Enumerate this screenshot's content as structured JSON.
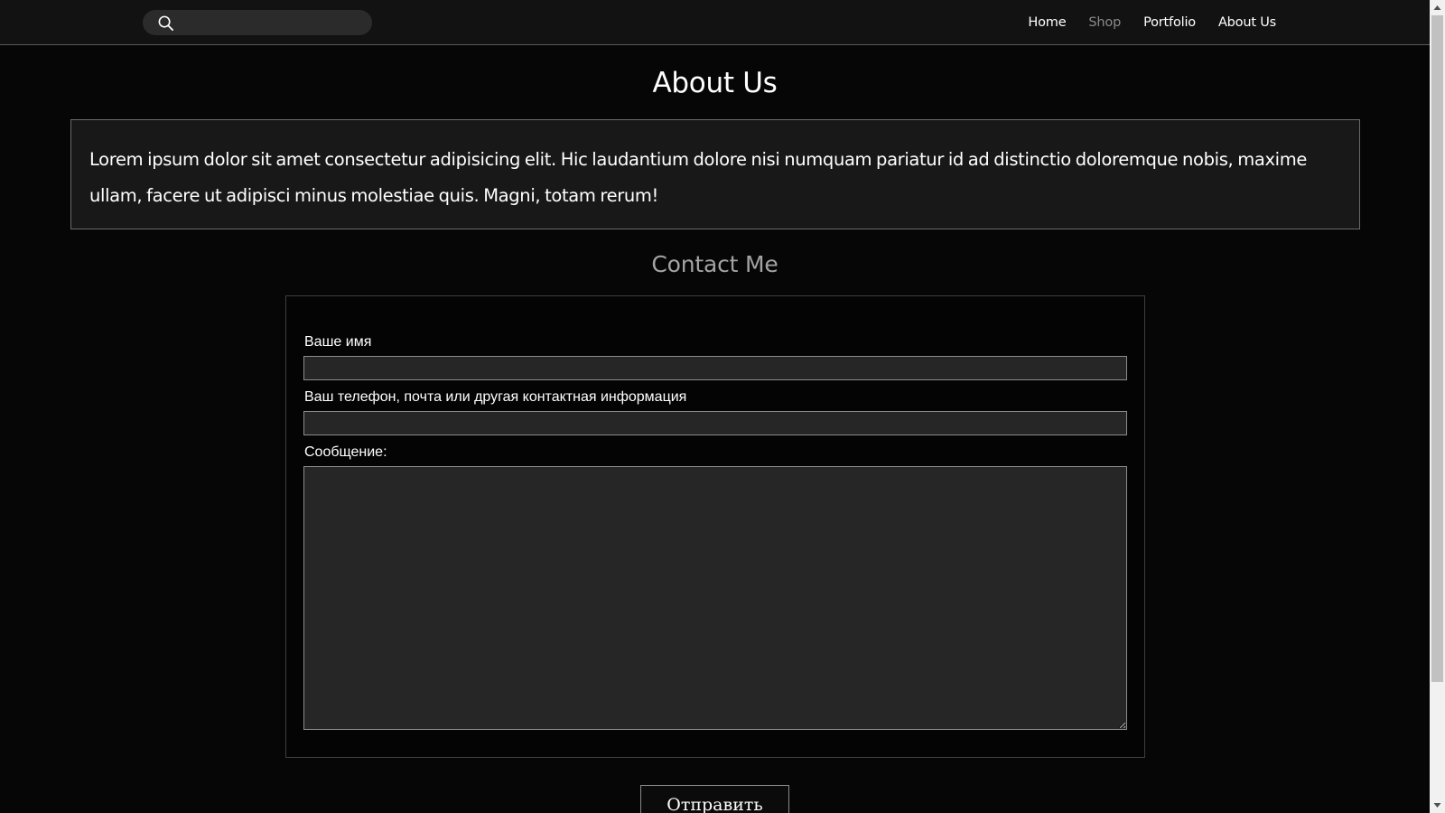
{
  "header": {
    "search": {
      "placeholder": "",
      "value": ""
    },
    "nav": [
      {
        "label": "Home"
      },
      {
        "label": "Shop"
      },
      {
        "label": "Portfolio"
      },
      {
        "label": "About Us"
      }
    ]
  },
  "main": {
    "title": "About Us",
    "about_text": "Lorem ipsum dolor sit amet consectetur adipisicing elit. Hic laudantium dolore nisi numquam pariatur id ad distinctio doloremque nobis, maxime ullam, facere ut adipisci minus molestiae quis. Magni, totam rerum!"
  },
  "contact": {
    "title": "Contact Me",
    "name_label": "Ваше имя",
    "name_value": "",
    "contact_label": "Ваш телефон, почта или другая контактная информация",
    "contact_value": "",
    "message_label": "Сообщение:",
    "message_value": "",
    "submit_label": "Отправить"
  },
  "colors": {
    "background": "#060606",
    "header_bg": "#121212",
    "nav_muted": "#8a8a8a",
    "field_bg": "#262626",
    "contact_title": "#a3a3a3"
  },
  "icons": {
    "search": "search-icon",
    "scroll_up": "scroll-up-arrow-icon",
    "scroll_down": "scroll-down-arrow-icon"
  }
}
